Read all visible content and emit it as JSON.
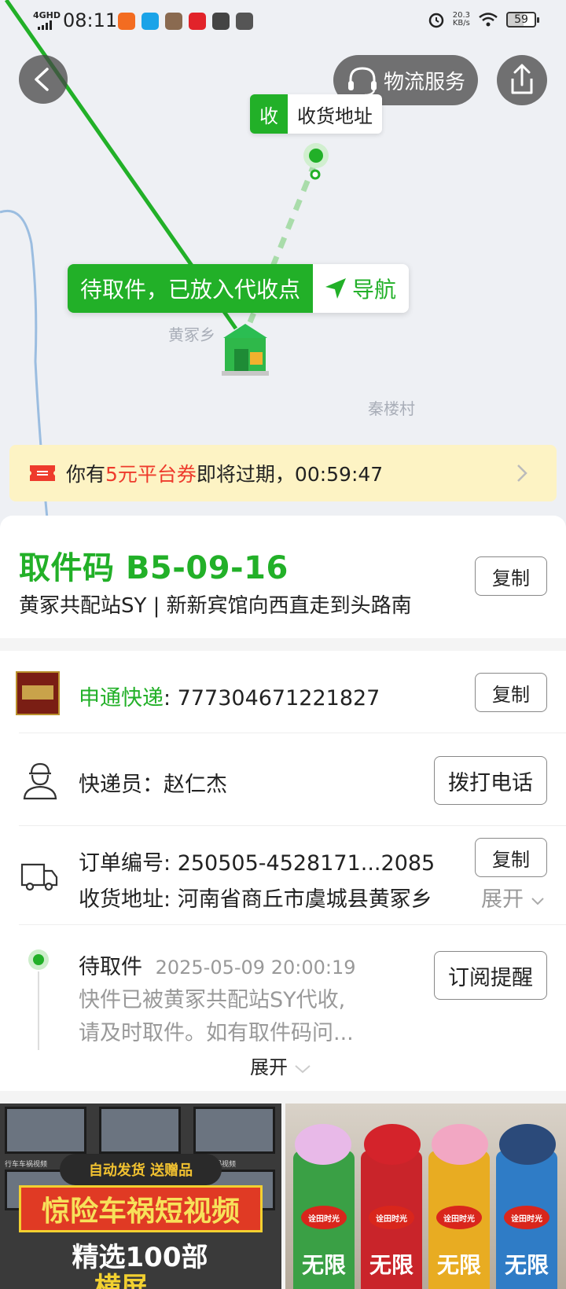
{
  "statusbar": {
    "network": "4GHD",
    "time": "08:11",
    "speed_value": "20.3",
    "speed_unit": "KB/s",
    "battery": "59"
  },
  "map": {
    "logistics_label": "物流服务",
    "address_tag": "收",
    "address_label": "收货地址",
    "pickup_status": "待取件，已放入代收点",
    "nav_label": "导航",
    "place_1": "黄冢乡",
    "place_2": "秦楼村"
  },
  "coupon": {
    "prefix": "你有",
    "highlight": "5元平台券",
    "suffix": "即将过期，00:59:47"
  },
  "pickup": {
    "code_label": "取件码",
    "code": "B5-09-16",
    "station": "黄冢共配站SY | 新新宾馆向西直走到头路南",
    "copy_label": "复制"
  },
  "shipment": {
    "carrier": "申通快递",
    "tracking_number": ": 777304671221827",
    "copy_label": "复制",
    "courier_label": "快递员：",
    "courier_name": "赵仁杰",
    "call_label": "拨打电话",
    "order_label": "订单编号:",
    "order_number": "250505-4528171...2085",
    "order_copy_label": "复制",
    "address_label": "收货地址:",
    "address_value": "河南省商丘市虞城县黄冢乡",
    "expand_address": "展开"
  },
  "tracking": {
    "status": "待取件",
    "datetime": "2025-05-09 20:00:19",
    "line1": "快件已被黄冢共配站SY代收,",
    "line2": "请及时取件。如有取件码问...",
    "subscribe_label": "订阅提醒",
    "expand_label": "展开"
  },
  "ads": {
    "left_banner_top": "自动发货 送赠品",
    "left_banner_main": "惊险车祸短视频",
    "left_banner_sub": "精选100部",
    "left_banner_bottom": "横屏",
    "thumb_caption": "行车车祸视频",
    "right_can_brand": "诠田时光",
    "right_can_text": "无限"
  },
  "colors": {
    "accent": "#22b028",
    "coupon_red": "#ee3b2c",
    "coupon_bg": "#fdf3c4"
  }
}
